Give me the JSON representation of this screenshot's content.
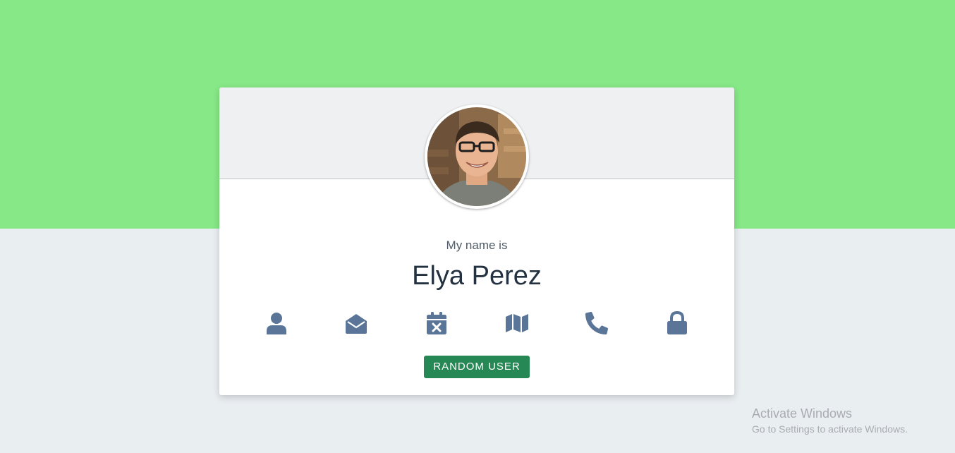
{
  "profile": {
    "label": "My name is",
    "value": "Elya Perez"
  },
  "icons": [
    {
      "name": "user-icon"
    },
    {
      "name": "envelope-open-icon"
    },
    {
      "name": "calendar-x-icon"
    },
    {
      "name": "map-icon"
    },
    {
      "name": "phone-icon"
    },
    {
      "name": "lock-icon"
    }
  ],
  "button": {
    "label": "RANDOM USER"
  },
  "watermark": {
    "title": "Activate Windows",
    "subtitle": "Go to Settings to activate Windows."
  },
  "colors": {
    "top_band": "#86e886",
    "page_background": "#e9eef1",
    "icon_color": "#5a7597",
    "button_color": "#268854",
    "name_color": "#243140"
  }
}
